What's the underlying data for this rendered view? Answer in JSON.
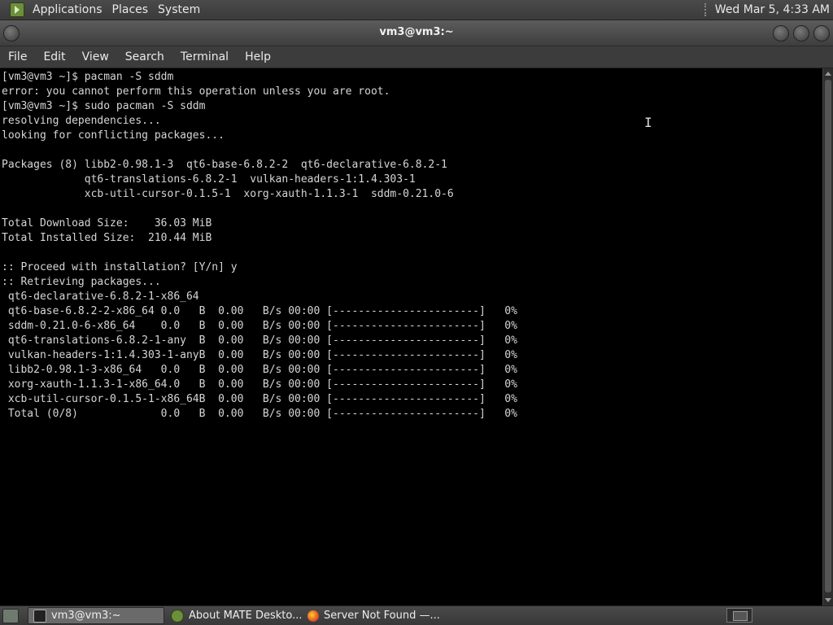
{
  "top_panel": {
    "menus": [
      "Applications",
      "Places",
      "System"
    ],
    "clock": "Wed Mar 5, 4:33 AM"
  },
  "window": {
    "title": "vm3@vm3:~"
  },
  "menubar": {
    "items": [
      "File",
      "Edit",
      "View",
      "Search",
      "Terminal",
      "Help"
    ]
  },
  "terminal": {
    "lines": [
      "[vm3@vm3 ~]$ pacman -S sddm",
      "error: you cannot perform this operation unless you are root.",
      "[vm3@vm3 ~]$ sudo pacman -S sddm",
      "resolving dependencies...",
      "looking for conflicting packages...",
      "",
      "Packages (8) libb2-0.98.1-3  qt6-base-6.8.2-2  qt6-declarative-6.8.2-1",
      "             qt6-translations-6.8.2-1  vulkan-headers-1:1.4.303-1",
      "             xcb-util-cursor-0.1.5-1  xorg-xauth-1.1.3-1  sddm-0.21.0-6",
      "",
      "Total Download Size:    36.03 MiB",
      "Total Installed Size:  210.44 MiB",
      "",
      ":: Proceed with installation? [Y/n] y",
      ":: Retrieving packages...",
      " qt6-declarative-6.8.2-1-x86_64",
      " qt6-base-6.8.2-2-x86_64 0.0   B  0.00   B/s 00:00 [-----------------------]   0%",
      " sddm-0.21.0-6-x86_64    0.0   B  0.00   B/s 00:00 [-----------------------]   0%",
      " qt6-translations-6.8.2-1-any  B  0.00   B/s 00:00 [-----------------------]   0%",
      " vulkan-headers-1:1.4.303-1-anyB  0.00   B/s 00:00 [-----------------------]   0%",
      " libb2-0.98.1-3-x86_64   0.0   B  0.00   B/s 00:00 [-----------------------]   0%",
      " xorg-xauth-1.1.3-1-x86_64.0   B  0.00   B/s 00:00 [-----------------------]   0%",
      " xcb-util-cursor-0.1.5-1-x86_64B  0.00   B/s 00:00 [-----------------------]   0%",
      " Total (0/8)             0.0   B  0.00   B/s 00:00 [-----------------------]   0%"
    ]
  },
  "taskbar": {
    "tasks": [
      {
        "label": "vm3@vm3:~",
        "icon": "terminal-icon",
        "active": true
      },
      {
        "label": "About MATE Deskto...",
        "icon": "mate-icon",
        "active": false
      },
      {
        "label": "Server Not Found —...",
        "icon": "firefox-icon",
        "active": false
      }
    ]
  },
  "colors": {
    "terminal_bg": "#000000",
    "terminal_fg": "#d6d6d6",
    "panel_bg": "#3a3a3a"
  }
}
